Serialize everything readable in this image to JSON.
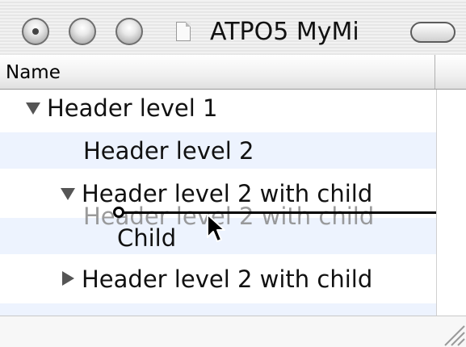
{
  "window": {
    "title": "ATPO5 MyMi"
  },
  "outline": {
    "column_header": "Name",
    "rows": [
      {
        "label": "Header level 1",
        "disclosure": "expanded"
      },
      {
        "label": "Header level 2",
        "disclosure": "none"
      },
      {
        "label": "Header level 2 with child",
        "disclosure": "expanded"
      },
      {
        "label": "",
        "disclosure": "none"
      },
      {
        "label": "Header level 2 with child",
        "disclosure": "collapsed"
      }
    ]
  },
  "drag": {
    "ghost_label": "Header level 2 with child",
    "child_label": "Child"
  },
  "colors": {
    "row_alt": "#edf3fe",
    "drop_indicator": "#000000"
  }
}
